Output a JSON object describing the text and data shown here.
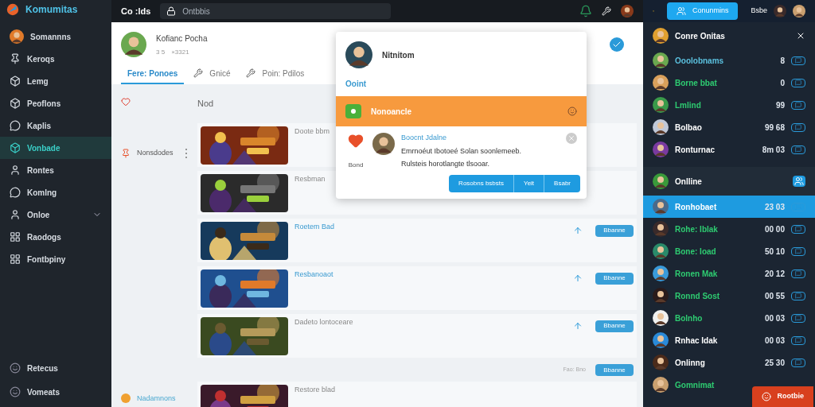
{
  "brand": {
    "name": "Komumitas"
  },
  "sidebar": {
    "items": [
      {
        "label": "Somannns",
        "kind": "avatar",
        "selected": false
      },
      {
        "label": "Keroqs",
        "kind": "pin",
        "selected": false
      },
      {
        "label": "Lemg",
        "kind": "box",
        "selected": false
      },
      {
        "label": "Peoflons",
        "kind": "box",
        "selected": false
      },
      {
        "label": "Kaplis",
        "kind": "chat",
        "selected": false
      },
      {
        "label": "Vonbade",
        "kind": "box",
        "selected": true
      },
      {
        "label": "Rontes",
        "kind": "user",
        "selected": false
      },
      {
        "label": "Komlng",
        "kind": "chat",
        "selected": false
      },
      {
        "label": "Onloe",
        "kind": "user",
        "selected": false,
        "expanded": false
      },
      {
        "label": "Raodogs",
        "kind": "grid",
        "selected": false
      },
      {
        "label": "Fontbpiny",
        "kind": "grid",
        "selected": false
      }
    ],
    "bottom": [
      {
        "label": "Retecus"
      },
      {
        "label": "Vomeats"
      }
    ]
  },
  "topbar": {
    "title": "Co :lds",
    "search": {
      "placeholder": "Ontbbis"
    }
  },
  "profile": {
    "name": "Kofianc Pocha",
    "stat_1": "3 5",
    "stat_2": "×3321"
  },
  "tabs": [
    {
      "label": "Fere: Ponoes",
      "selected": true
    },
    {
      "label": "Gnicé",
      "selected": false
    },
    {
      "label": "Poin: Pdilos",
      "selected": false
    }
  ],
  "feed": {
    "heading": "Nod",
    "groups": [
      {
        "label": "Nonsdodes"
      },
      {
        "label": "Nadamnons"
      }
    ],
    "games": [
      {
        "title": "Doote bbm",
        "highlight": false
      },
      {
        "title": "Resbman",
        "highlight": false
      },
      {
        "title": "Roetem Bad",
        "highlight": true,
        "action": "Bbanne"
      },
      {
        "title": "Resbanoaot",
        "highlight": true,
        "action": "Bbanne"
      },
      {
        "title": "Dadeto lontoceare",
        "highlight": false,
        "action": "Bbanne"
      }
    ],
    "footer": {
      "meta": "Fao: Bno",
      "action": "Bbanne"
    },
    "last": {
      "title": "Restore blad"
    }
  },
  "popup": {
    "name": "Nitnitom",
    "link": "Ooint",
    "banner": "Nonoancle",
    "notice": {
      "title": "Boocnt Jdalne",
      "line_1": "Emrnoéut Ibotoeé Solan soonlemeeb.",
      "tag": "Bond",
      "line_2": "Rulsteis horotlangte tlsooar."
    },
    "buttons": [
      "Rosobns bsbsts",
      "Yeit",
      "Bsabr"
    ]
  },
  "right": {
    "top_button": "Conunmins",
    "top_label": "Bsbe",
    "title": "Conre Onitas",
    "friends": [
      {
        "name": "Ooolobnams",
        "color": "#5bc0de",
        "stat": "8"
      },
      {
        "name": "Borne bbat",
        "color": "#2ecc71",
        "stat": "0"
      },
      {
        "name": "Lmlind",
        "color": "#2ecc71",
        "stat": "99"
      },
      {
        "name": "Bolbao",
        "color": "#ffffff",
        "stat": "99 68"
      },
      {
        "name": "Ronturnac",
        "color": "#ffffff",
        "stat": "8m 03"
      }
    ],
    "section": "Onlline",
    "online": [
      {
        "name": "Ronhobaet",
        "color": "#ffffff",
        "stat": "23 03",
        "selected": true
      },
      {
        "name": "Rohe: Iblak",
        "color": "#2ecc71",
        "stat": "00 00",
        "selected": false
      },
      {
        "name": "Bone: Ioad",
        "color": "#2ecc71",
        "stat": "50 10",
        "selected": false
      },
      {
        "name": "Ronen Mak",
        "color": "#2ecc71",
        "stat": "20 12",
        "selected": false
      },
      {
        "name": "Ronnd Sost",
        "color": "#2ecc71",
        "stat": "00 55",
        "selected": false
      },
      {
        "name": "Bolnho",
        "color": "#2ecc71",
        "stat": "00 03",
        "selected": false
      },
      {
        "name": "Rnhac Idak",
        "color": "#ffffff",
        "stat": "00 03",
        "selected": false
      },
      {
        "name": "Onlinng",
        "color": "#ffffff",
        "stat": "25 30",
        "selected": false
      },
      {
        "name": "Gomnimat",
        "color": "#2ecc71",
        "selected": false
      }
    ],
    "float_button": "Rootbie"
  }
}
